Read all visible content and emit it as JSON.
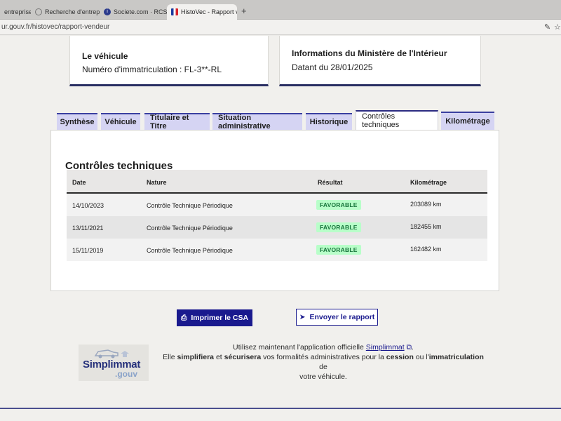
{
  "browser": {
    "tabs": [
      {
        "label": "entreprises",
        "active": false
      },
      {
        "label": "Recherche d'entreprises",
        "active": false
      },
      {
        "label": "Societe.com · RCS, s ret, s",
        "active": false
      },
      {
        "label": "HistoVec - Rapport vende",
        "active": true
      }
    ],
    "new_tab": "+",
    "url": "ur.gouv.fr/histovec/rapport-vendeur"
  },
  "vehicle_card": {
    "title": "Le véhicule",
    "plate_label": "Numéro d'immatriculation : FL-3**-RL"
  },
  "ministry_card": {
    "title": "Informations du Ministère de l'Intérieur",
    "date_label": "Datant du 28/01/2025"
  },
  "tabs": [
    {
      "label": "Synthèse"
    },
    {
      "label": "Véhicule"
    },
    {
      "label": "Titulaire et Titre"
    },
    {
      "label": "Situation administrative"
    },
    {
      "label": "Historique"
    },
    {
      "label": "Contrôles techniques"
    },
    {
      "label": "Kilométrage"
    }
  ],
  "selected_tab": "Contrôles techniques",
  "section": {
    "title": "Contrôles techniques",
    "columns": [
      "Date",
      "Nature",
      "Résultat",
      "Kilométrage"
    ],
    "rows": [
      {
        "date": "14/10/2023",
        "nature": "Contrôle Technique Périodique",
        "result": "FAVORABLE",
        "km": "203089 km"
      },
      {
        "date": "13/11/2021",
        "nature": "Contrôle Technique Périodique",
        "result": "FAVORABLE",
        "km": "182455 km"
      },
      {
        "date": "15/11/2019",
        "nature": "Contrôle Technique Périodique",
        "result": "FAVORABLE",
        "km": "162482 km"
      }
    ]
  },
  "actions": {
    "print": "Imprimer le CSA",
    "send": "Envoyer le rapport"
  },
  "promo": {
    "logo_main": "Simplimmat",
    "logo_sub": ".gouv",
    "line1_prefix": "Utilisez maintenant l'application officielle",
    "link": "Simplimmat",
    "line2_a": "Elle",
    "line2_b": "simplifiera",
    "line2_c": "et",
    "line2_d": "sécurisera",
    "line2_e": "vos formalités administratives pour la",
    "line2_f": "cession",
    "line2_g": "ou l'",
    "line2_h": "immatriculation",
    "line2_i": "de",
    "line3": "votre véhicule."
  },
  "colors": {
    "primary": "#1a1a8e",
    "badge_bg": "#b8fec9",
    "badge_text": "#18753c",
    "tab_bg": "#d5d4f3"
  }
}
